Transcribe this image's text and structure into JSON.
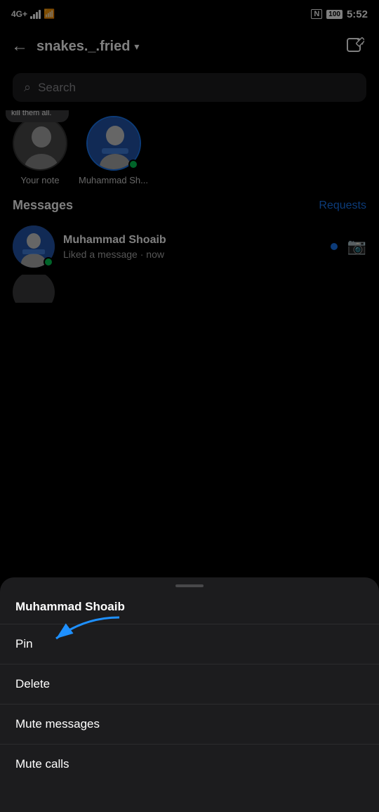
{
  "statusBar": {
    "signal": "4G+",
    "time": "5:52",
    "battery": "100"
  },
  "header": {
    "backLabel": "←",
    "username": "snakes._.fried",
    "dropdownSymbol": "▾",
    "editIcon": "edit"
  },
  "search": {
    "placeholder": "Search"
  },
  "stories": [
    {
      "id": "your-note",
      "label": "Your note",
      "hasNote": true,
      "noteText": "No matter i will kill them all.",
      "hasOnline": false
    },
    {
      "id": "muhammad-sh",
      "label": "Muhammad Sh...",
      "hasNote": false,
      "hasOnline": true
    }
  ],
  "messagesSection": {
    "label": "Messages",
    "requestsLabel": "Requests"
  },
  "messageItems": [
    {
      "id": "msg-1",
      "name": "Muhammad Shoaib",
      "preview": "Liked a message",
      "time": "now",
      "hasOnline": true,
      "hasUnread": true,
      "hasCamera": true
    }
  ],
  "bottomSheet": {
    "title": "Muhammad Shoaib",
    "items": [
      {
        "id": "pin",
        "label": "Pin",
        "hasArrow": true
      },
      {
        "id": "delete",
        "label": "Delete"
      },
      {
        "id": "mute-messages",
        "label": "Mute messages"
      },
      {
        "id": "mute-calls",
        "label": "Mute calls"
      }
    ]
  }
}
